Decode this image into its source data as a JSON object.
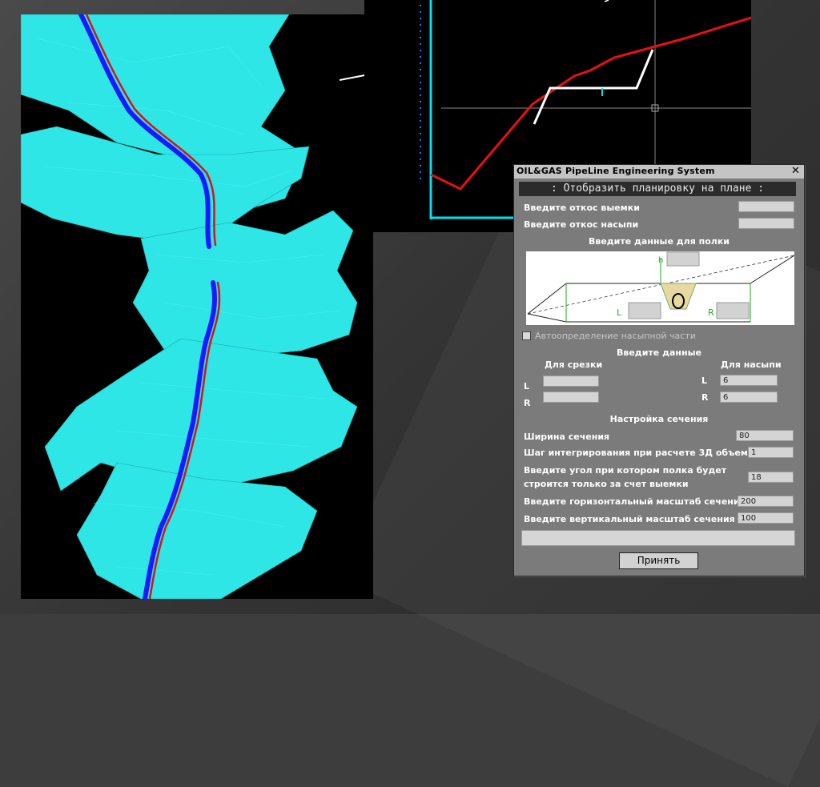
{
  "window": {
    "title": "OIL&GAS PipeLine Engineering System",
    "close_glyph": "✕",
    "header": ": Отобразить планировку на плане :"
  },
  "slopes": {
    "cut_label": "Введите откос выемки",
    "cut_value": "",
    "fill_label": "Введите откос насыпи",
    "fill_value": ""
  },
  "shelf": {
    "title": "Введите данные для полки",
    "diagram_h_label": "h",
    "diagram_l_label": "L",
    "diagram_r_label": "R"
  },
  "auto_fill": {
    "label": "Автоопределение насыпной части",
    "checked": false
  },
  "data_entry": {
    "title": "Введите данные",
    "cut_header": "Для срезки",
    "fill_header": "Для насыпи",
    "l_label": "L",
    "r_label": "R",
    "cut_l": "",
    "cut_r": "",
    "fill_l": "6",
    "fill_r": "6"
  },
  "section": {
    "title": "Настройка сечения",
    "width_label": "Ширина сечения",
    "width_value": "80",
    "step_label": "Шаг интегрирования при расчете 3Д объема",
    "step_value": "1",
    "angle_label_1": "Введите угол при котором полка будет",
    "angle_label_2": "строится только за счет выемки",
    "angle_value": "18",
    "hscale_label": "Введите горизонтальный масштаб сечения",
    "hscale_value": "200",
    "vscale_label": "Введите вертикальный масштаб сечения",
    "vscale_value": "100"
  },
  "status_text": "",
  "accept_button": "Принять",
  "colors": {
    "terrain": "#2ee6e6",
    "terrain_edge": "#1aa8a8",
    "pipe_route": "#1a1aff",
    "pipe_axis": "#e01010",
    "profile_axis": "#00e0f0",
    "profile_line": "#e81010",
    "design_line": "#ffffff",
    "dialog_bg": "#7b7b7b"
  }
}
